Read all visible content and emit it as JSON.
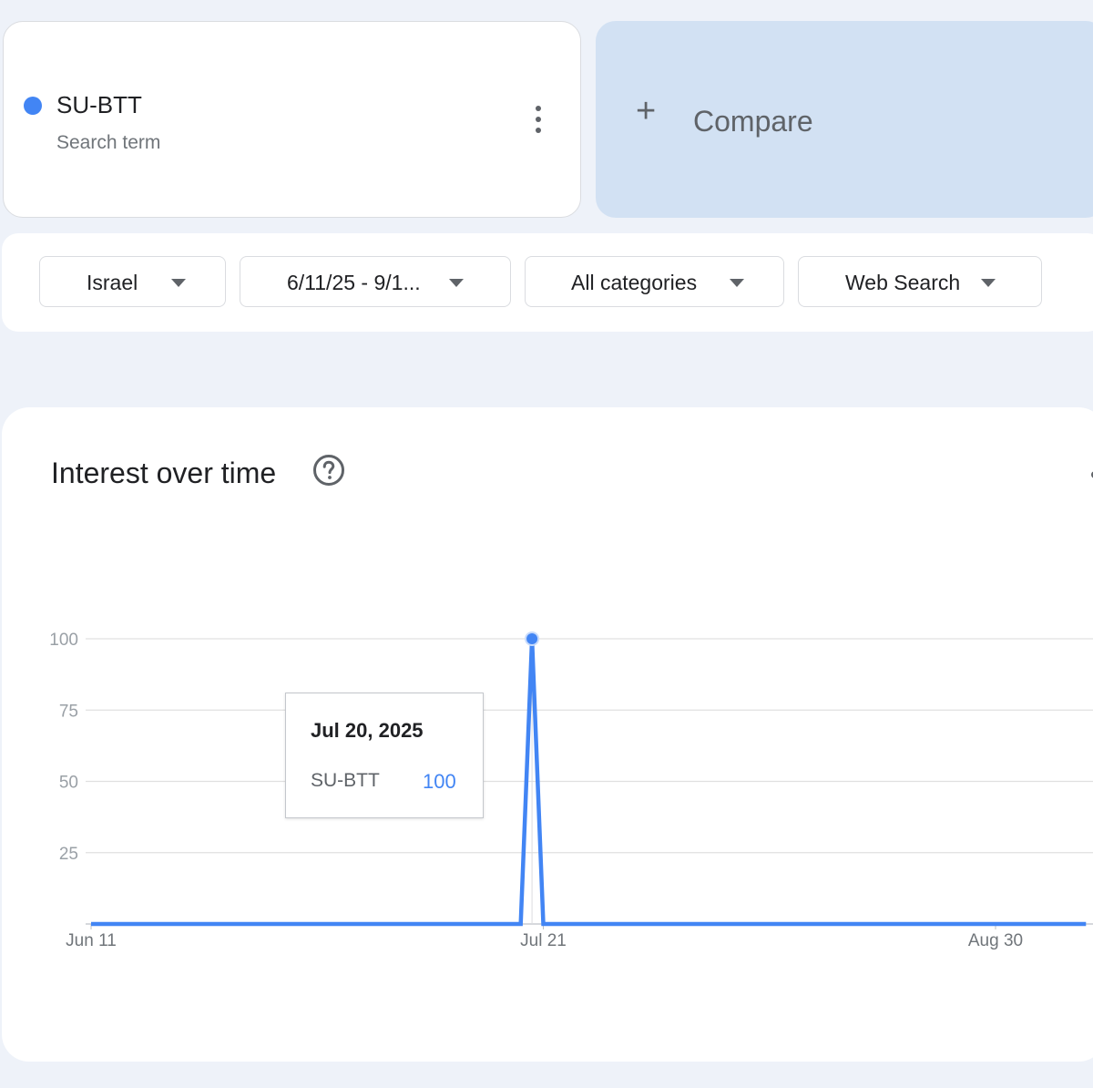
{
  "search_term": {
    "name": "SU-BTT",
    "subtitle": "Search term",
    "color": "#4285f4"
  },
  "compare": {
    "label": "Compare",
    "icon": "plus-icon"
  },
  "filters": [
    {
      "label": "Israel",
      "icon": "caret-down-icon"
    },
    {
      "label": "6/11/25 - 9/1...",
      "icon": "caret-down-icon"
    },
    {
      "label": "All categories",
      "icon": "caret-down-icon"
    },
    {
      "label": "Web Search",
      "icon": "caret-down-icon"
    }
  ],
  "chart": {
    "title": "Interest over time",
    "help_icon": "help-circle-icon"
  },
  "tooltip": {
    "date": "Jul 20, 2025",
    "series": "SU-BTT",
    "value": "100"
  },
  "chart_data": {
    "type": "line",
    "xlabel": "",
    "ylabel": "",
    "ylim": [
      0,
      100
    ],
    "yticks": [
      25,
      50,
      75,
      100
    ],
    "x_ticks": [
      "Jun 11",
      "Jul 21",
      "Aug 30"
    ],
    "x_range": [
      "2025-06-11",
      "2025-09-07"
    ],
    "grid": true,
    "series": [
      {
        "name": "SU-BTT",
        "color": "#4285f4",
        "points": [
          [
            "2025-06-11",
            0
          ],
          [
            "2025-07-19",
            0
          ],
          [
            "2025-07-20",
            100
          ],
          [
            "2025-07-21",
            0
          ],
          [
            "2025-09-07",
            0
          ]
        ]
      }
    ],
    "highlight": {
      "x": "2025-07-20",
      "y": 100
    }
  }
}
